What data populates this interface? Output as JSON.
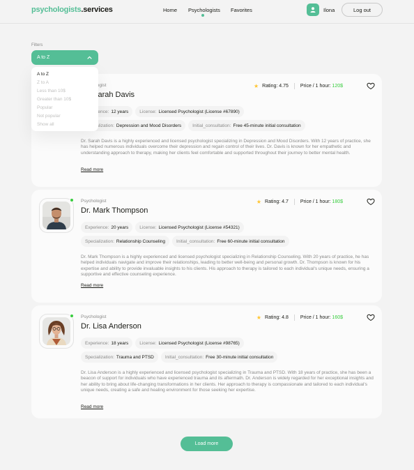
{
  "header": {
    "logo_brand": "psychologists",
    "logo_suffix": ".services",
    "nav": {
      "home": "Home",
      "psychologists": "Psychologists",
      "favorites": "Favorites"
    },
    "user_name": "Ilona",
    "logout_label": "Log out"
  },
  "filters": {
    "label": "Filters",
    "selected": "A to Z",
    "options": [
      "A to Z",
      "Z to A",
      "Less than 10$",
      "Greater than 10$",
      "Popular",
      "Not popular",
      "Show all"
    ]
  },
  "psychologists": [
    {
      "role": "Psychologist",
      "name": "Dr. Sarah Davis",
      "rating_label": "Rating: 4.75",
      "price_label": "Price / 1 hour:",
      "price": "120$",
      "experience_key": "Experience:",
      "experience": "12 years",
      "license_key": "License:",
      "license": "Licensed Psychologist (License #67890)",
      "specialization_key": "Specialization:",
      "specialization": "Depression and Mood Disorders",
      "consultation_key": "Initial_consultation:",
      "consultation": "Free 45-minute initial consultation",
      "description": "Dr. Sarah Davis is a highly experienced and licensed psychologist specializing in Depression and Mood Disorders. With 12 years of practice, she has helped numerous individuals overcome their depression and regain control of their lives. Dr. Davis is known for her empathetic and understanding approach to therapy, making her clients feel comfortable and supported throughout their journey to better mental health.",
      "read_more": "Read more"
    },
    {
      "role": "Psychologist",
      "name": "Dr. Mark Thompson",
      "rating_label": "Rating: 4.7",
      "price_label": "Price / 1 hour:",
      "price": "180$",
      "experience_key": "Experience:",
      "experience": "20 years",
      "license_key": "License:",
      "license": "Licensed Psychologist (License #54321)",
      "specialization_key": "Specialization:",
      "specialization": "Relationship Counseling",
      "consultation_key": "Initial_consultation:",
      "consultation": "Free 60-minute initial consultation",
      "description": "Dr. Mark Thompson is a highly experienced and licensed psychologist specializing in Relationship Counseling. With 20 years of practice, he has helped individuals navigate and improve their relationships, leading to better well-being and personal growth. Dr. Thompson is known for his expertise and ability to provide invaluable insights to his clients. His approach to therapy is tailored to each individual's unique needs, ensuring a supportive and effective counseling experience.",
      "read_more": "Read more"
    },
    {
      "role": "Psychologist",
      "name": "Dr. Lisa Anderson",
      "rating_label": "Rating: 4.8",
      "price_label": "Price / 1 hour:",
      "price": "160$",
      "experience_key": "Experience:",
      "experience": "18 years",
      "license_key": "License:",
      "license": "Licensed Psychologist (License #98765)",
      "specialization_key": "Specialization:",
      "specialization": "Trauma and PTSD",
      "consultation_key": "Initial_consultation:",
      "consultation": "Free 30-minute initial consultation",
      "description": "Dr. Lisa Anderson is a highly experienced and licensed psychologist specializing in Trauma and PTSD. With 18 years of practice, she has been a beacon of support for individuals who have experienced trauma and its aftermath. Dr. Anderson is widely regarded for her exceptional insights and her ability to bring about life-changing transformations in her clients. Her approach to therapy is compassionate and tailored to each individual's unique needs, creating a safe and healing environment for those seeking her expertise.",
      "read_more": "Read more"
    }
  ],
  "load_more_label": "Load more",
  "colors": {
    "accent": "#54be96",
    "price": "#38cd3e",
    "star": "#ffc531",
    "online": "#38cd3e"
  },
  "icons": [
    "user-icon",
    "chevron-up-icon",
    "star-icon",
    "heart-icon"
  ]
}
